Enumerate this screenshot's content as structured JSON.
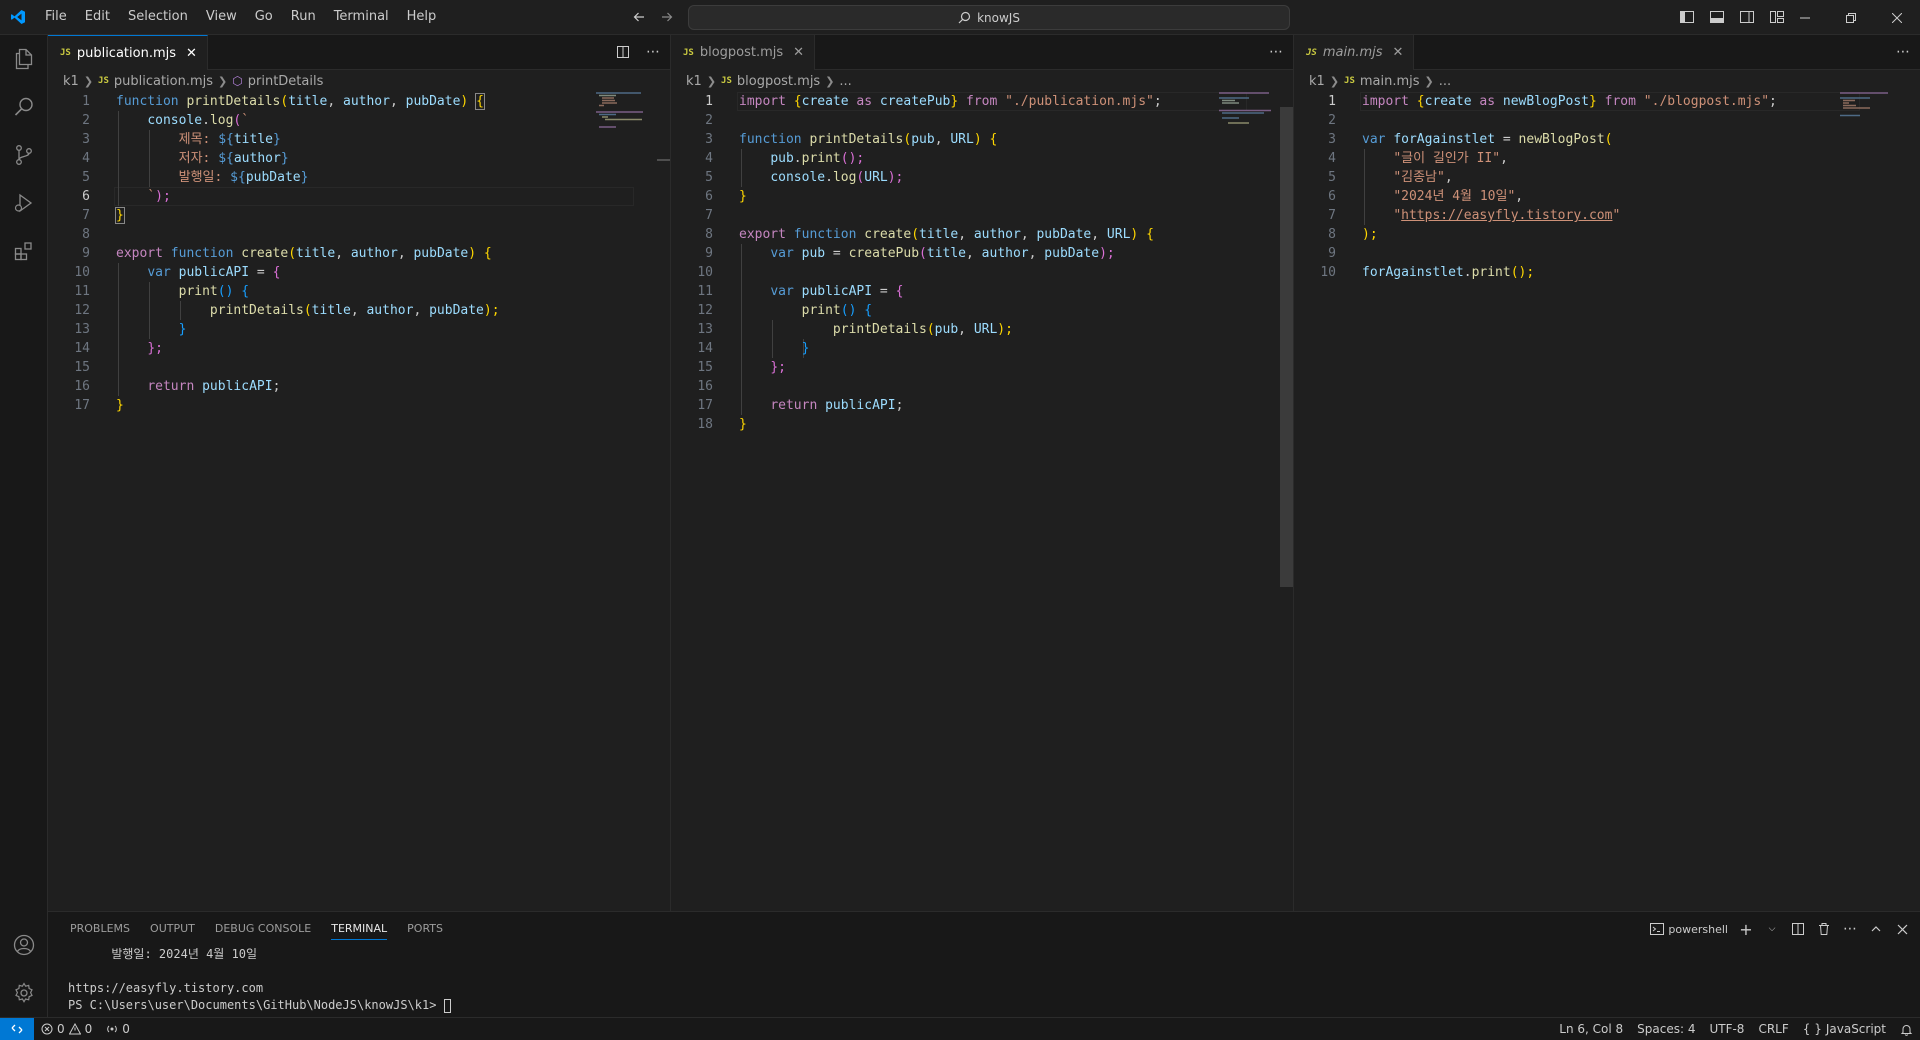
{
  "titlebar": {
    "menu": [
      "File",
      "Edit",
      "Selection",
      "View",
      "Go",
      "Run",
      "Terminal",
      "Help"
    ],
    "search_text": "knowJS"
  },
  "activity": {
    "icons": [
      "explorer-icon",
      "search-icon",
      "source-control-icon",
      "run-debug-icon",
      "extensions-icon",
      "account-icon",
      "settings-gear-icon"
    ]
  },
  "groups": [
    {
      "tab_label": "publication.mjs",
      "tab_badge": "JS",
      "breadcrumb": {
        "folder": "k1",
        "file": "publication.mjs",
        "symbol": "printDetails"
      },
      "line_numbers": [
        "1",
        "2",
        "3",
        "4",
        "5",
        "6",
        "7",
        "8",
        "9",
        "10",
        "11",
        "12",
        "13",
        "14",
        "15",
        "16",
        "17"
      ],
      "current_line": 6
    },
    {
      "tab_label": "blogpost.mjs",
      "tab_badge": "JS",
      "breadcrumb": {
        "folder": "k1",
        "file": "blogpost.mjs",
        "symbol": "..."
      },
      "line_numbers": [
        "1",
        "2",
        "3",
        "4",
        "5",
        "6",
        "7",
        "8",
        "9",
        "10",
        "11",
        "12",
        "13",
        "14",
        "15",
        "16",
        "17",
        "18"
      ],
      "current_line": 1
    },
    {
      "tab_label": "main.mjs",
      "tab_badge": "JS",
      "breadcrumb": {
        "folder": "k1",
        "file": "main.mjs",
        "symbol": "..."
      },
      "line_numbers": [
        "1",
        "2",
        "3",
        "4",
        "5",
        "6",
        "7",
        "8",
        "9",
        "10"
      ],
      "current_line": 1
    }
  ],
  "code": {
    "g1": {
      "l1": [
        "function",
        " ",
        "printDetails",
        "(",
        "title",
        ", ",
        "author",
        ", ",
        "pubDate",
        ") ",
        "{"
      ],
      "l2": [
        "console",
        ".",
        "log",
        "(",
        "`"
      ],
      "l3": [
        "제목: ",
        "${",
        "title",
        "}"
      ],
      "l4": [
        "저자: ",
        "${",
        "author",
        "}"
      ],
      "l5": [
        "발행일: ",
        "${",
        "pubDate",
        "}"
      ],
      "l6": [
        "`",
        ");"
      ],
      "l7": [
        "}"
      ],
      "l9": [
        "export",
        " ",
        "function",
        " ",
        "create",
        "(",
        "title",
        ", ",
        "author",
        ", ",
        "pubDate",
        ") ",
        "{"
      ],
      "l10": [
        "var",
        " ",
        "publicAPI",
        " = ",
        "{"
      ],
      "l11": [
        "print",
        "() ",
        "{"
      ],
      "l12": [
        "printDetails",
        "(",
        "title",
        ", ",
        "author",
        ", ",
        "pubDate",
        ");"
      ],
      "l13": [
        "}"
      ],
      "l14": [
        "};"
      ],
      "l16": [
        "return",
        " ",
        "publicAPI",
        ";"
      ],
      "l17": [
        "}"
      ]
    },
    "g2": {
      "l1": [
        "import",
        " ",
        "{",
        "create",
        " ",
        "as",
        " ",
        "createPub",
        "}",
        " ",
        "from",
        " ",
        "\"./publication.mjs\"",
        ";"
      ],
      "l3": [
        "function",
        " ",
        "printDetails",
        "(",
        "pub",
        ", ",
        "URL",
        ") ",
        "{"
      ],
      "l4": [
        "pub",
        ".",
        "print",
        "();"
      ],
      "l5": [
        "console",
        ".",
        "log",
        "(",
        "URL",
        ");"
      ],
      "l6": [
        "}"
      ],
      "l8": [
        "export",
        " ",
        "function",
        " ",
        "create",
        "(",
        "title",
        ", ",
        "author",
        ", ",
        "pubDate",
        ", ",
        "URL",
        ") ",
        "{"
      ],
      "l9": [
        "var",
        " ",
        "pub",
        " = ",
        "createPub",
        "(",
        "title",
        ", ",
        "author",
        ", ",
        "pubDate",
        ");"
      ],
      "l11": [
        "var",
        " ",
        "publicAPI",
        " = ",
        "{"
      ],
      "l12": [
        "print",
        "() ",
        "{"
      ],
      "l13": [
        "printDetails",
        "(",
        "pub",
        ", ",
        "URL",
        ");"
      ],
      "l14": [
        "}"
      ],
      "l15": [
        "};"
      ],
      "l17": [
        "return",
        " ",
        "publicAPI",
        ";"
      ],
      "l18": [
        "}"
      ]
    },
    "g3": {
      "l1": [
        "import",
        " ",
        "{",
        "create",
        " ",
        "as",
        " ",
        "newBlogPost",
        "}",
        " ",
        "from",
        " ",
        "\"./blogpost.mjs\"",
        ";"
      ],
      "l3": [
        "var",
        " ",
        "forAgainstlet",
        " = ",
        "newBlogPost",
        "("
      ],
      "l4": [
        "\"글이 길인가 II\"",
        ","
      ],
      "l5": [
        "\"김종남\"",
        ","
      ],
      "l6": [
        "\"2024년 4월 10일\"",
        ","
      ],
      "l7": [
        "\"",
        "https://easyfly.tistory.com",
        "\""
      ],
      "l8": [
        ");"
      ],
      "l10": [
        "forAgainstlet",
        ".",
        "print",
        "();"
      ]
    }
  },
  "panel": {
    "tabs": [
      "PROBLEMS",
      "OUTPUT",
      "DEBUG CONSOLE",
      "TERMINAL",
      "PORTS"
    ],
    "active_tab": "TERMINAL",
    "shell": "powershell",
    "terminal_lines": [
      "      발행일: 2024년 4월 10일",
      "",
      "https://easyfly.tistory.com",
      "PS C:\\Users\\user\\Documents\\GitHub\\NodeJS\\knowJS\\k1> "
    ]
  },
  "statusbar": {
    "errors": "0",
    "warnings": "0",
    "ports": "0",
    "position": "Ln 6, Col 8",
    "spaces": "Spaces: 4",
    "encoding": "UTF-8",
    "eol": "CRLF",
    "language": "JavaScript"
  },
  "colors": {
    "accent": "#0078d4",
    "keyword": "#569cd6",
    "control": "#c586c0",
    "function": "#dcdcaa",
    "variable": "#9cdcfe",
    "string": "#ce9178",
    "bracket1": "#ffd700",
    "bracket2": "#da70d6",
    "bracket3": "#179fff"
  }
}
